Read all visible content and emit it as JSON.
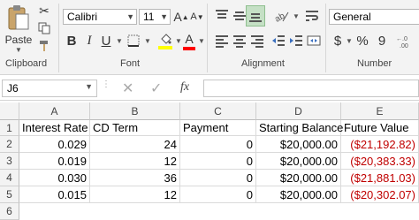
{
  "ribbon": {
    "clipboard": {
      "paste_label": "Paste",
      "group_label": "Clipboard"
    },
    "font": {
      "font_name": "Calibri",
      "font_size": "11",
      "grow_label": "A",
      "shrink_label": "A",
      "bold": "B",
      "italic": "I",
      "underline": "U",
      "font_color_label": "A",
      "group_label": "Font"
    },
    "alignment": {
      "group_label": "Alignment"
    },
    "number": {
      "format": "General",
      "currency": "$",
      "percent": "%",
      "comma": "9",
      "group_label": "Number"
    }
  },
  "formula_bar": {
    "name_box": "J6",
    "fx": "fx",
    "formula": ""
  },
  "sheet": {
    "columns": [
      "A",
      "B",
      "C",
      "D",
      "E"
    ],
    "rows": [
      "1",
      "2",
      "3",
      "4",
      "5",
      "6"
    ],
    "headers": [
      "Interest Rate",
      "CD Term",
      "Payment",
      "Starting Balance",
      "Future Value"
    ],
    "data": [
      [
        "0.029",
        "24",
        "0",
        "$20,000.00",
        "($21,192.82)"
      ],
      [
        "0.019",
        "12",
        "0",
        "$20,000.00",
        "($20,383.33)"
      ],
      [
        "0.030",
        "36",
        "0",
        "$20,000.00",
        "($21,881.03)"
      ],
      [
        "0.015",
        "12",
        "0",
        "$20,000.00",
        "($20,302.07)"
      ]
    ]
  },
  "colors": {
    "negative": "#c00000",
    "fill_swatch": "#ffff00",
    "font_swatch": "#ff0000"
  }
}
